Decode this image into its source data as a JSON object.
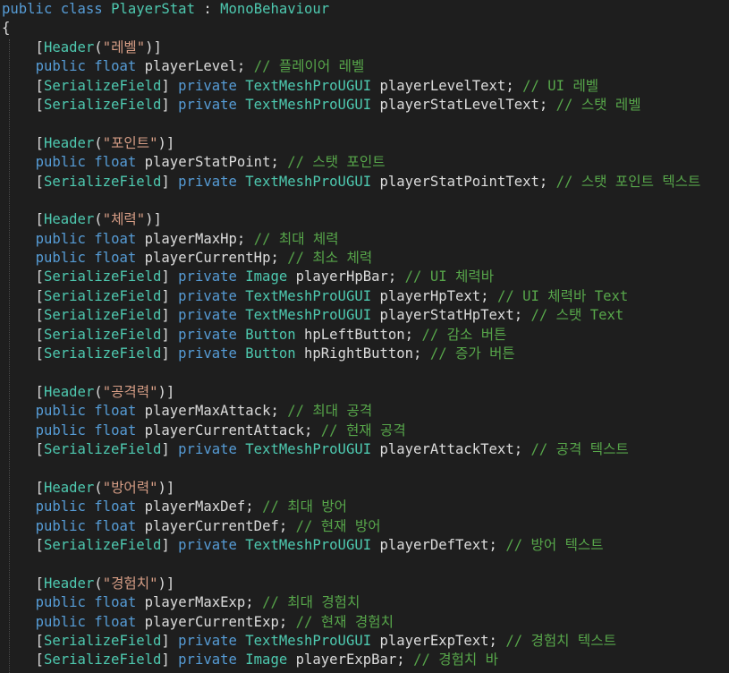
{
  "editor": {
    "lines": [
      {
        "tokens": [
          {
            "t": "public",
            "c": "kw"
          },
          {
            "t": " ",
            "c": "pl"
          },
          {
            "t": "class",
            "c": "kw"
          },
          {
            "t": " ",
            "c": "pl"
          },
          {
            "t": "PlayerStat",
            "c": "ty"
          },
          {
            "t": " : ",
            "c": "pl"
          },
          {
            "t": "MonoBehaviour",
            "c": "ty"
          }
        ]
      },
      {
        "tokens": [
          {
            "t": "{",
            "c": "pl"
          }
        ]
      },
      {
        "tokens": [
          {
            "t": "    [",
            "c": "pl"
          },
          {
            "t": "Header",
            "c": "attr"
          },
          {
            "t": "(",
            "c": "pl"
          },
          {
            "t": "\"레벨\"",
            "c": "str"
          },
          {
            "t": ")]",
            "c": "pl"
          }
        ]
      },
      {
        "tokens": [
          {
            "t": "    ",
            "c": "pl"
          },
          {
            "t": "public",
            "c": "kw"
          },
          {
            "t": " ",
            "c": "pl"
          },
          {
            "t": "float",
            "c": "kw"
          },
          {
            "t": " playerLevel; ",
            "c": "pl"
          },
          {
            "t": "// 플레이어 레벨",
            "c": "cm"
          }
        ]
      },
      {
        "tokens": [
          {
            "t": "    [",
            "c": "pl"
          },
          {
            "t": "SerializeField",
            "c": "attr"
          },
          {
            "t": "] ",
            "c": "pl"
          },
          {
            "t": "private",
            "c": "kw"
          },
          {
            "t": " ",
            "c": "pl"
          },
          {
            "t": "TextMeshProUGUI",
            "c": "ty"
          },
          {
            "t": " playerLevelText; ",
            "c": "pl"
          },
          {
            "t": "// UI 레벨",
            "c": "cm"
          }
        ]
      },
      {
        "tokens": [
          {
            "t": "    [",
            "c": "pl"
          },
          {
            "t": "SerializeField",
            "c": "attr"
          },
          {
            "t": "] ",
            "c": "pl"
          },
          {
            "t": "private",
            "c": "kw"
          },
          {
            "t": " ",
            "c": "pl"
          },
          {
            "t": "TextMeshProUGUI",
            "c": "ty"
          },
          {
            "t": " playerStatLevelText; ",
            "c": "pl"
          },
          {
            "t": "// 스탯 레벨",
            "c": "cm"
          }
        ]
      },
      {
        "tokens": []
      },
      {
        "tokens": [
          {
            "t": "    [",
            "c": "pl"
          },
          {
            "t": "Header",
            "c": "attr"
          },
          {
            "t": "(",
            "c": "pl"
          },
          {
            "t": "\"포인트\"",
            "c": "str"
          },
          {
            "t": ")]",
            "c": "pl"
          }
        ]
      },
      {
        "tokens": [
          {
            "t": "    ",
            "c": "pl"
          },
          {
            "t": "public",
            "c": "kw"
          },
          {
            "t": " ",
            "c": "pl"
          },
          {
            "t": "float",
            "c": "kw"
          },
          {
            "t": " playerStatPoint; ",
            "c": "pl"
          },
          {
            "t": "// 스탯 포인트",
            "c": "cm"
          }
        ]
      },
      {
        "tokens": [
          {
            "t": "    [",
            "c": "pl"
          },
          {
            "t": "SerializeField",
            "c": "attr"
          },
          {
            "t": "] ",
            "c": "pl"
          },
          {
            "t": "private",
            "c": "kw"
          },
          {
            "t": " ",
            "c": "pl"
          },
          {
            "t": "TextMeshProUGUI",
            "c": "ty"
          },
          {
            "t": " playerStatPointText; ",
            "c": "pl"
          },
          {
            "t": "// 스탯 포인트 텍스트",
            "c": "cm"
          }
        ]
      },
      {
        "tokens": []
      },
      {
        "tokens": [
          {
            "t": "    [",
            "c": "pl"
          },
          {
            "t": "Header",
            "c": "attr"
          },
          {
            "t": "(",
            "c": "pl"
          },
          {
            "t": "\"체력\"",
            "c": "str"
          },
          {
            "t": ")]",
            "c": "pl"
          }
        ]
      },
      {
        "tokens": [
          {
            "t": "    ",
            "c": "pl"
          },
          {
            "t": "public",
            "c": "kw"
          },
          {
            "t": " ",
            "c": "pl"
          },
          {
            "t": "float",
            "c": "kw"
          },
          {
            "t": " playerMaxHp; ",
            "c": "pl"
          },
          {
            "t": "// 최대 체력",
            "c": "cm"
          }
        ]
      },
      {
        "tokens": [
          {
            "t": "    ",
            "c": "pl"
          },
          {
            "t": "public",
            "c": "kw"
          },
          {
            "t": " ",
            "c": "pl"
          },
          {
            "t": "float",
            "c": "kw"
          },
          {
            "t": " playerCurrentHp; ",
            "c": "pl"
          },
          {
            "t": "// 최소 체력",
            "c": "cm"
          }
        ]
      },
      {
        "tokens": [
          {
            "t": "    [",
            "c": "pl"
          },
          {
            "t": "SerializeField",
            "c": "attr"
          },
          {
            "t": "] ",
            "c": "pl"
          },
          {
            "t": "private",
            "c": "kw"
          },
          {
            "t": " ",
            "c": "pl"
          },
          {
            "t": "Image",
            "c": "ty"
          },
          {
            "t": " playerHpBar; ",
            "c": "pl"
          },
          {
            "t": "// UI 체력바",
            "c": "cm"
          }
        ]
      },
      {
        "tokens": [
          {
            "t": "    [",
            "c": "pl"
          },
          {
            "t": "SerializeField",
            "c": "attr"
          },
          {
            "t": "] ",
            "c": "pl"
          },
          {
            "t": "private",
            "c": "kw"
          },
          {
            "t": " ",
            "c": "pl"
          },
          {
            "t": "TextMeshProUGUI",
            "c": "ty"
          },
          {
            "t": " playerHpText; ",
            "c": "pl"
          },
          {
            "t": "// UI 체력바 Text",
            "c": "cm"
          }
        ]
      },
      {
        "tokens": [
          {
            "t": "    [",
            "c": "pl"
          },
          {
            "t": "SerializeField",
            "c": "attr"
          },
          {
            "t": "] ",
            "c": "pl"
          },
          {
            "t": "private",
            "c": "kw"
          },
          {
            "t": " ",
            "c": "pl"
          },
          {
            "t": "TextMeshProUGUI",
            "c": "ty"
          },
          {
            "t": " playerStatHpText; ",
            "c": "pl"
          },
          {
            "t": "// 스탯 Text",
            "c": "cm"
          }
        ]
      },
      {
        "tokens": [
          {
            "t": "    [",
            "c": "pl"
          },
          {
            "t": "SerializeField",
            "c": "attr"
          },
          {
            "t": "] ",
            "c": "pl"
          },
          {
            "t": "private",
            "c": "kw"
          },
          {
            "t": " ",
            "c": "pl"
          },
          {
            "t": "Button",
            "c": "ty"
          },
          {
            "t": " hpLeftButton; ",
            "c": "pl"
          },
          {
            "t": "// 감소 버튼",
            "c": "cm"
          }
        ]
      },
      {
        "tokens": [
          {
            "t": "    [",
            "c": "pl"
          },
          {
            "t": "SerializeField",
            "c": "attr"
          },
          {
            "t": "] ",
            "c": "pl"
          },
          {
            "t": "private",
            "c": "kw"
          },
          {
            "t": " ",
            "c": "pl"
          },
          {
            "t": "Button",
            "c": "ty"
          },
          {
            "t": " hpRightButton; ",
            "c": "pl"
          },
          {
            "t": "// 증가 버튼",
            "c": "cm"
          }
        ]
      },
      {
        "tokens": []
      },
      {
        "tokens": [
          {
            "t": "    [",
            "c": "pl"
          },
          {
            "t": "Header",
            "c": "attr"
          },
          {
            "t": "(",
            "c": "pl"
          },
          {
            "t": "\"공격력\"",
            "c": "str"
          },
          {
            "t": ")]",
            "c": "pl"
          }
        ]
      },
      {
        "tokens": [
          {
            "t": "    ",
            "c": "pl"
          },
          {
            "t": "public",
            "c": "kw"
          },
          {
            "t": " ",
            "c": "pl"
          },
          {
            "t": "float",
            "c": "kw"
          },
          {
            "t": " playerMaxAttack; ",
            "c": "pl"
          },
          {
            "t": "// 최대 공격",
            "c": "cm"
          }
        ]
      },
      {
        "tokens": [
          {
            "t": "    ",
            "c": "pl"
          },
          {
            "t": "public",
            "c": "kw"
          },
          {
            "t": " ",
            "c": "pl"
          },
          {
            "t": "float",
            "c": "kw"
          },
          {
            "t": " playerCurrentAttack; ",
            "c": "pl"
          },
          {
            "t": "// 현재 공격",
            "c": "cm"
          }
        ]
      },
      {
        "tokens": [
          {
            "t": "    [",
            "c": "pl"
          },
          {
            "t": "SerializeField",
            "c": "attr"
          },
          {
            "t": "] ",
            "c": "pl"
          },
          {
            "t": "private",
            "c": "kw"
          },
          {
            "t": " ",
            "c": "pl"
          },
          {
            "t": "TextMeshProUGUI",
            "c": "ty"
          },
          {
            "t": " playerAttackText; ",
            "c": "pl"
          },
          {
            "t": "// 공격 텍스트",
            "c": "cm"
          }
        ]
      },
      {
        "tokens": []
      },
      {
        "tokens": [
          {
            "t": "    [",
            "c": "pl"
          },
          {
            "t": "Header",
            "c": "attr"
          },
          {
            "t": "(",
            "c": "pl"
          },
          {
            "t": "\"방어력\"",
            "c": "str"
          },
          {
            "t": ")]",
            "c": "pl"
          }
        ]
      },
      {
        "tokens": [
          {
            "t": "    ",
            "c": "pl"
          },
          {
            "t": "public",
            "c": "kw"
          },
          {
            "t": " ",
            "c": "pl"
          },
          {
            "t": "float",
            "c": "kw"
          },
          {
            "t": " playerMaxDef; ",
            "c": "pl"
          },
          {
            "t": "// 최대 방어",
            "c": "cm"
          }
        ]
      },
      {
        "tokens": [
          {
            "t": "    ",
            "c": "pl"
          },
          {
            "t": "public",
            "c": "kw"
          },
          {
            "t": " ",
            "c": "pl"
          },
          {
            "t": "float",
            "c": "kw"
          },
          {
            "t": " playerCurrentDef; ",
            "c": "pl"
          },
          {
            "t": "// 현재 방어",
            "c": "cm"
          }
        ]
      },
      {
        "tokens": [
          {
            "t": "    [",
            "c": "pl"
          },
          {
            "t": "SerializeField",
            "c": "attr"
          },
          {
            "t": "] ",
            "c": "pl"
          },
          {
            "t": "private",
            "c": "kw"
          },
          {
            "t": " ",
            "c": "pl"
          },
          {
            "t": "TextMeshProUGUI",
            "c": "ty"
          },
          {
            "t": " playerDefText; ",
            "c": "pl"
          },
          {
            "t": "// 방어 텍스트",
            "c": "cm"
          }
        ]
      },
      {
        "tokens": []
      },
      {
        "tokens": [
          {
            "t": "    [",
            "c": "pl"
          },
          {
            "t": "Header",
            "c": "attr"
          },
          {
            "t": "(",
            "c": "pl"
          },
          {
            "t": "\"경험치\"",
            "c": "str"
          },
          {
            "t": ")]",
            "c": "pl"
          }
        ]
      },
      {
        "tokens": [
          {
            "t": "    ",
            "c": "pl"
          },
          {
            "t": "public",
            "c": "kw"
          },
          {
            "t": " ",
            "c": "pl"
          },
          {
            "t": "float",
            "c": "kw"
          },
          {
            "t": " playerMaxExp; ",
            "c": "pl"
          },
          {
            "t": "// 최대 경험치",
            "c": "cm"
          }
        ]
      },
      {
        "tokens": [
          {
            "t": "    ",
            "c": "pl"
          },
          {
            "t": "public",
            "c": "kw"
          },
          {
            "t": " ",
            "c": "pl"
          },
          {
            "t": "float",
            "c": "kw"
          },
          {
            "t": " playerCurrentExp; ",
            "c": "pl"
          },
          {
            "t": "// 현재 경험치",
            "c": "cm"
          }
        ]
      },
      {
        "tokens": [
          {
            "t": "    [",
            "c": "pl"
          },
          {
            "t": "SerializeField",
            "c": "attr"
          },
          {
            "t": "] ",
            "c": "pl"
          },
          {
            "t": "private",
            "c": "kw"
          },
          {
            "t": " ",
            "c": "pl"
          },
          {
            "t": "TextMeshProUGUI",
            "c": "ty"
          },
          {
            "t": " playerExpText; ",
            "c": "pl"
          },
          {
            "t": "// 경험치 텍스트",
            "c": "cm"
          }
        ]
      },
      {
        "tokens": [
          {
            "t": "    [",
            "c": "pl"
          },
          {
            "t": "SerializeField",
            "c": "attr"
          },
          {
            "t": "] ",
            "c": "pl"
          },
          {
            "t": "private",
            "c": "kw"
          },
          {
            "t": " ",
            "c": "pl"
          },
          {
            "t": "Image",
            "c": "ty"
          },
          {
            "t": " playerExpBar; ",
            "c": "pl"
          },
          {
            "t": "// 경험치 바",
            "c": "cm"
          }
        ]
      }
    ]
  }
}
